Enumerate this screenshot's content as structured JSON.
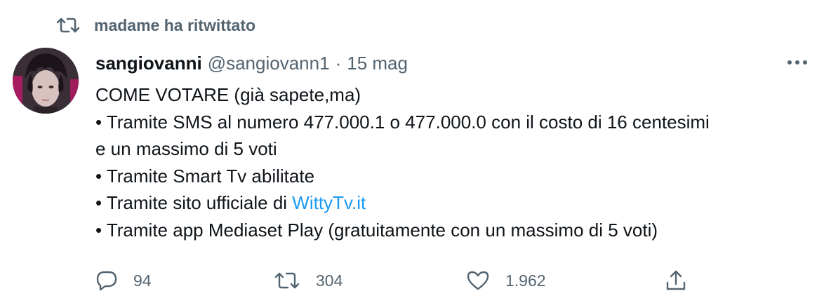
{
  "retweet_context": {
    "icon": "retweet-icon",
    "text": "madame ha ritwittato"
  },
  "tweet": {
    "author": {
      "display_name": "sangiovanni",
      "handle": "@sangiovann1",
      "avatar": "avatar"
    },
    "separator": "·",
    "timestamp": "15 mag",
    "more_icon": "more-horizontal-icon",
    "body": {
      "line1": "COME VOTARE (già sapete,ma)",
      "line2": "• Tramite SMS al numero 477.000.1 o 477.000.0 con il costo di 16 centesimi",
      "line3": "e un massimo di 5 voti",
      "line4": "• Tramite Smart Tv abilitate",
      "line5_prefix": "• Tramite sito ufficiale di ",
      "line5_link": "WittyTv.it",
      "line6": "• Tramite app Mediaset Play (gratuitamente con un massimo di 5 voti)"
    },
    "actions": {
      "reply": {
        "icon": "reply-icon",
        "count": "94"
      },
      "retweet": {
        "icon": "retweet-icon",
        "count": "304"
      },
      "like": {
        "icon": "heart-icon",
        "count": "1.962"
      },
      "share": {
        "icon": "share-icon"
      }
    }
  },
  "colors": {
    "text_primary": "#0f1419",
    "text_secondary": "#536471",
    "link": "#1d9bf0",
    "background": "#ffffff"
  }
}
